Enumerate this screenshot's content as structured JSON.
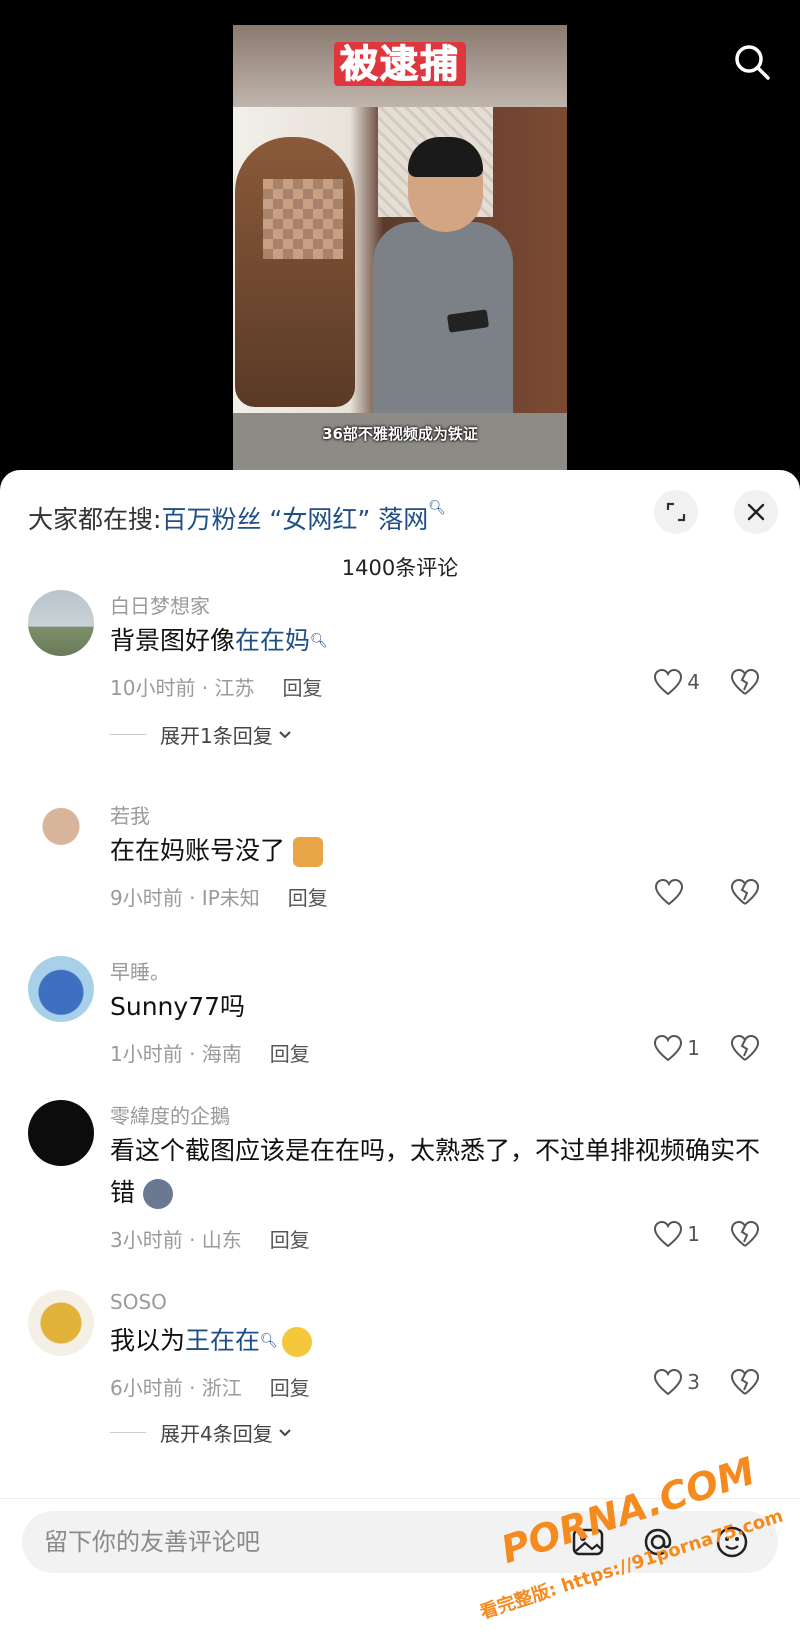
{
  "video": {
    "title": "被逮捕",
    "caption": "36部不雅视频成为铁证"
  },
  "sheet": {
    "hot_prefix": "大家都在搜:",
    "hot_keyword": "百万粉丝 “女网红” 落网",
    "count": "1400条评论"
  },
  "comments": [
    {
      "user": "白日梦想家",
      "text_plain": "背景图好像",
      "text_link": "在在妈",
      "time": "10小时前 · 江苏",
      "reply": "回复",
      "likes": "4",
      "expand": "展开1条回复"
    },
    {
      "user": "若我",
      "text_plain": "在在妈账号没了",
      "time": "9小时前 · IP未知",
      "reply": "回复",
      "likes": ""
    },
    {
      "user": "早睡。",
      "text_plain": "Sunny77吗",
      "time": "1小时前 · 海南",
      "reply": "回复",
      "likes": "1"
    },
    {
      "user": "零緯度的企鵝",
      "text_plain": "看这个截图应该是在在吗，太熟悉了，不过单排视频确实不错",
      "time": "3小时前 · 山东",
      "reply": "回复",
      "likes": "1"
    },
    {
      "user": "SOSO",
      "text_plain": "我以为",
      "text_link": "王在在",
      "time": "6小时前 · 浙江",
      "reply": "回复",
      "likes": "3",
      "expand": "展开4条回复"
    }
  ],
  "input": {
    "placeholder": "留下你的友善评论吧"
  },
  "watermark": {
    "line1": "PORNA.COM",
    "line2": "看完整版: https://91porna75.com"
  },
  "colors": {
    "link": "#1f4f86",
    "watermark": "#f58a1f"
  }
}
